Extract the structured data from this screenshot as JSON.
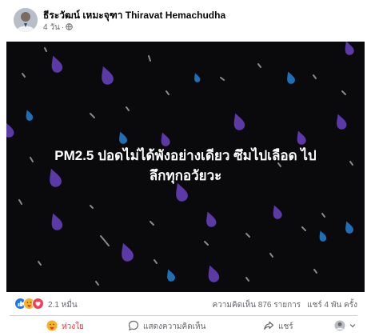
{
  "post": {
    "author": "ธีระวัฒน์ เหมะจุฑา Thiravat Hemachudha",
    "timestamp": "4 วัน",
    "audience_icon": "globe-icon",
    "image_text": {
      "line1": "PM2.5 ปอดไม่ได้พังอย่างเดียว ซึมไปเลือด ไป",
      "line2": "ลึกทุกอวัยวะ"
    }
  },
  "stats": {
    "reaction_icons": [
      "like",
      "care",
      "love"
    ],
    "reaction_count": "2.1 หมื่น",
    "comments": "ความคิดเห็น 876 รายการ",
    "shares": "แชร์ 4 พัน ครั้ง"
  },
  "actions": {
    "like_label": "ห่วงใย",
    "comment_label": "แสดงความคิดเห็น",
    "share_label": "แชร์"
  },
  "colors": {
    "image_background": "#0a0a0c",
    "drop_purple": "#5b3aa8",
    "drop_blue": "#1f6fb8",
    "streak_gray": "#8a8a8a",
    "care_active": "#e53935"
  }
}
